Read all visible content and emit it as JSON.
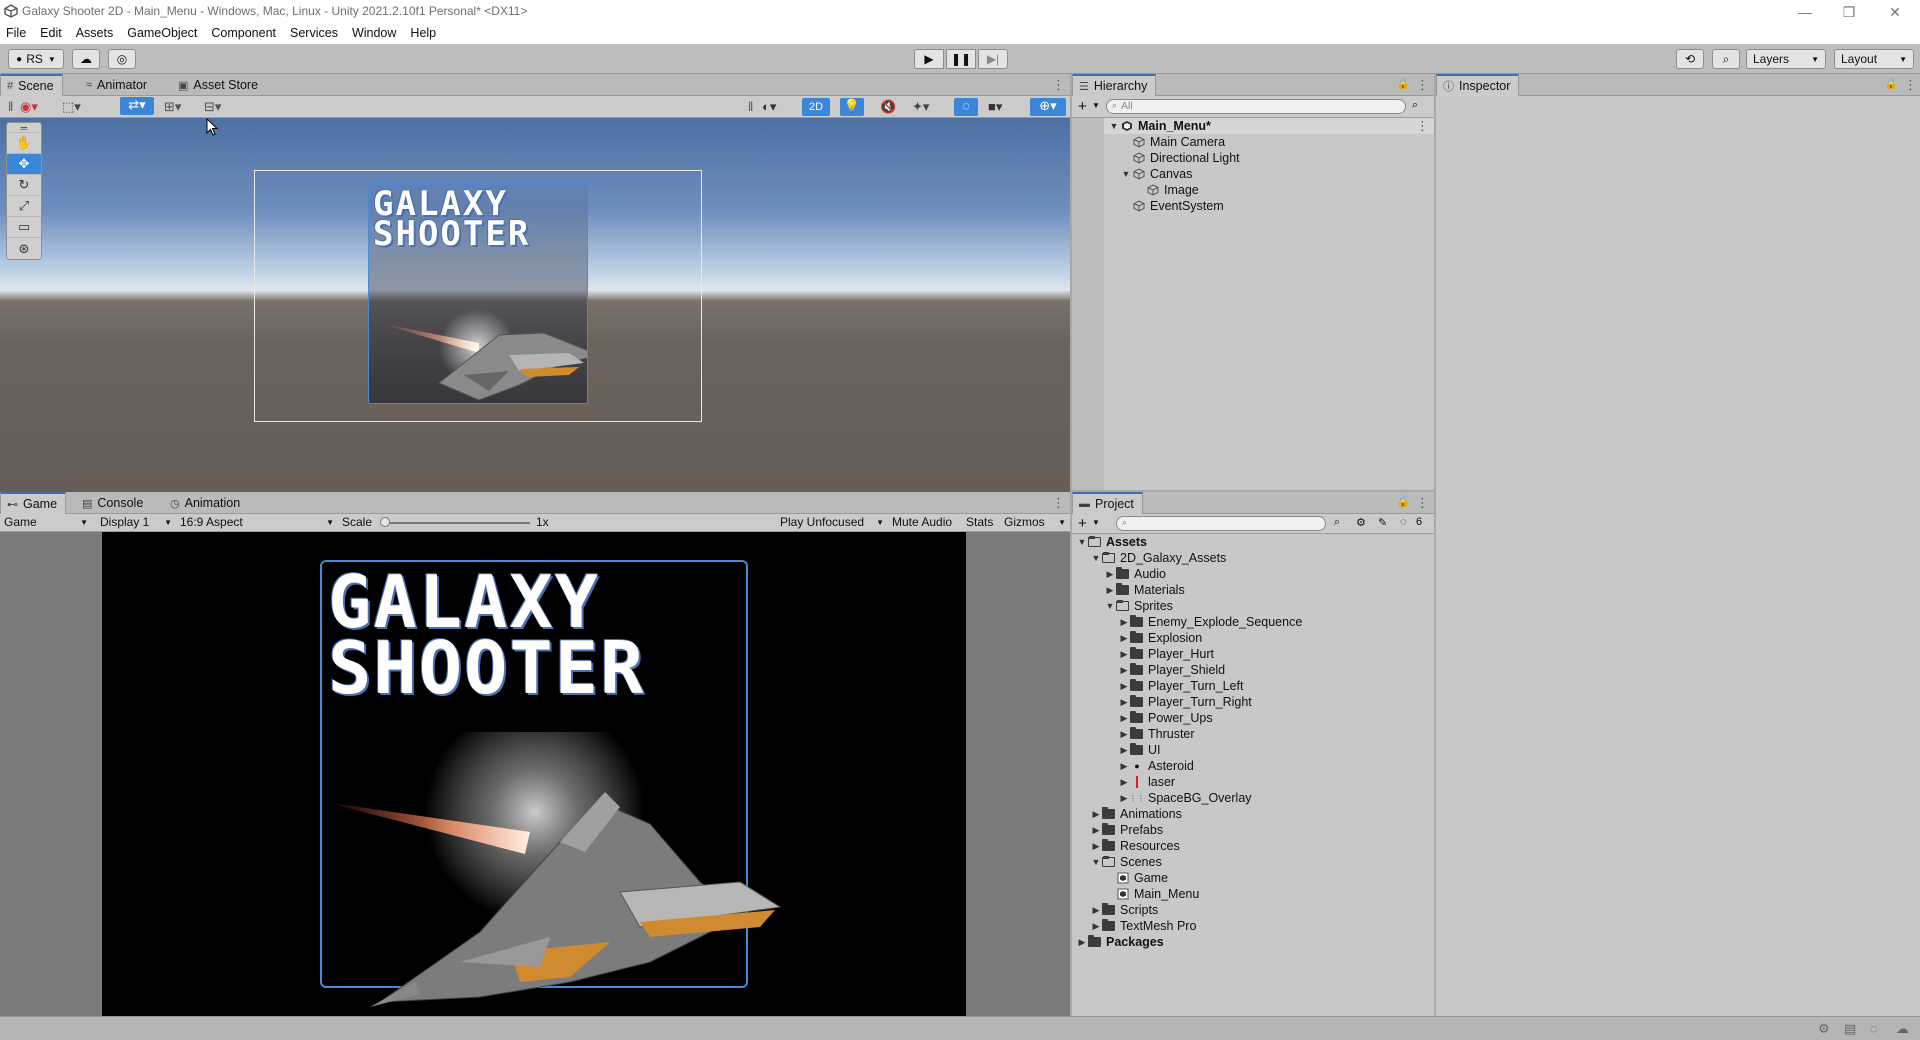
{
  "window": {
    "title": "Galaxy Shooter 2D - Main_Menu - Windows, Mac, Linux - Unity 2021.2.10f1 Personal* <DX11>"
  },
  "menu": [
    "File",
    "Edit",
    "Assets",
    "GameObject",
    "Component",
    "Services",
    "Window",
    "Help"
  ],
  "toolbar": {
    "account": "RS",
    "layers": "Layers",
    "layout": "Layout"
  },
  "scene": {
    "tabs": [
      "Scene",
      "Animator",
      "Asset Store"
    ],
    "mode_2d": "2D"
  },
  "game": {
    "tabs": [
      "Game",
      "Console",
      "Animation"
    ],
    "view_select": "Game",
    "display": "Display 1",
    "aspect": "16:9 Aspect",
    "scale_label": "Scale",
    "scale_value": "1x",
    "play_mode": "Play Unfocused",
    "mute": "Mute Audio",
    "stats": "Stats",
    "gizmos": "Gizmos"
  },
  "logo": {
    "line1": "GALAXY",
    "line2": "SHOOTER"
  },
  "hierarchy": {
    "tab": "Hierarchy",
    "search_placeholder": "All",
    "scene": "Main_Menu*",
    "items": {
      "main_camera": "Main Camera",
      "directional_light": "Directional Light",
      "canvas": "Canvas",
      "image": "Image",
      "event_system": "EventSystem"
    }
  },
  "inspector": {
    "tab": "Inspector"
  },
  "project": {
    "tab": "Project",
    "hidden_count": "6",
    "assets": "Assets",
    "galaxy_assets": "2D_Galaxy_Assets",
    "audio": "Audio",
    "materials": "Materials",
    "sprites": "Sprites",
    "sprite_items": {
      "s0": "Enemy_Explode_Sequence",
      "s1": "Explosion",
      "s2": "Player_Hurt",
      "s3": "Player_Shield",
      "s4": "Player_Turn_Left",
      "s5": "Player_Turn_Right",
      "s6": "Power_Ups",
      "s7": "Thruster",
      "s8": "UI",
      "s9": "Asteroid",
      "s10": "laser",
      "s11": "SpaceBG_Overlay"
    },
    "animations": "Animations",
    "prefabs": "Prefabs",
    "resources": "Resources",
    "scenes": "Scenes",
    "scene_game": "Game",
    "scene_main": "Main_Menu",
    "scripts": "Scripts",
    "textmesh": "TextMesh Pro",
    "packages": "Packages"
  },
  "colors": {
    "accent": "#3a86d8",
    "panel": "#c8c8c8",
    "toolbar": "#bdbdbd"
  }
}
